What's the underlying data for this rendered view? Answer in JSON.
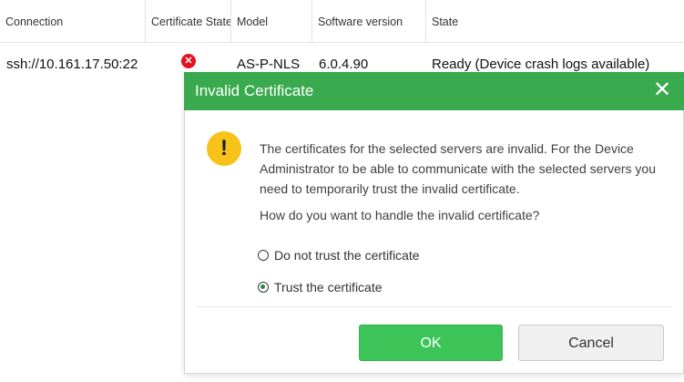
{
  "table": {
    "headers": [
      "Connection",
      "Certificate State",
      "Model",
      "Software version",
      "State"
    ],
    "row": {
      "connection": "ssh://10.161.17.50:22",
      "certificate_state_icon": "error-x-icon",
      "model": "AS-P-NLS",
      "software_version": "6.0.4.90",
      "state": "Ready (Device crash logs available)"
    }
  },
  "dialog": {
    "title": "Invalid Certificate",
    "close_glyph": "✕",
    "warning_glyph": "!",
    "message": "The certificates for the selected servers are invalid.  For the Device Administrator to be able to communicate with the selected servers you need to temporarily trust the invalid certificate.",
    "question": "How do you want to handle the invalid certificate?",
    "options": [
      {
        "label": "Do not trust the certificate",
        "selected": false
      },
      {
        "label": "Trust the certificate",
        "selected": true
      }
    ],
    "ok_label": "OK",
    "cancel_label": "Cancel"
  },
  "colors": {
    "titlebar": "#3aaa4e",
    "ok_button": "#3cc459",
    "warning": "#f7c31b",
    "error": "#e81123"
  }
}
